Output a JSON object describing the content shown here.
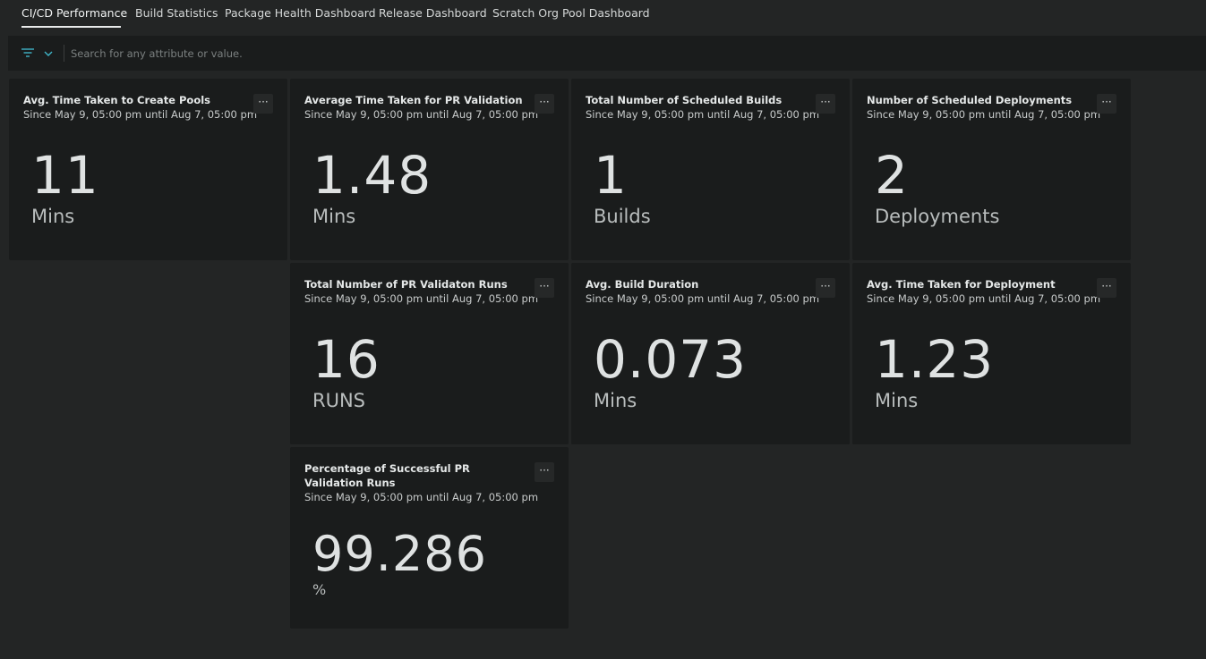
{
  "tabs": [
    {
      "label": "CI/CD Performance",
      "active": true
    },
    {
      "label": "Build Statistics"
    },
    {
      "label": "Package Health Dashboard"
    },
    {
      "label": "Release Dashboard"
    },
    {
      "label": "Scratch Org Pool Dashboard"
    }
  ],
  "filter": {
    "placeholder": "Search for any attribute or value.",
    "icons": [
      "filter-icon",
      "chevron-down-icon"
    ]
  },
  "range": "Since May 9, 05:00 pm until Aug 7, 05:00 pm",
  "menu_label": "···",
  "cards": [
    {
      "title": "Avg. Time Taken to Create Pools",
      "value": "11",
      "unit": "Mins"
    },
    {
      "title": "Average Time Taken for PR Validation",
      "value": "1.48",
      "unit": "Mins"
    },
    {
      "title": "Total Number of Scheduled Builds",
      "value": "1",
      "unit": "Builds"
    },
    {
      "title": "Number of Scheduled Deployments",
      "value": "2",
      "unit": "Deployments"
    },
    {
      "title": "Total Number of PR Validaton Runs",
      "value": "16",
      "unit": "RUNS"
    },
    {
      "title": "Avg. Build Duration",
      "value": "0.073",
      "unit": "Mins"
    },
    {
      "title": "Avg. Time Taken for Deployment",
      "value": "1.23",
      "unit": "Mins"
    },
    {
      "title": "Percentage of Successful PR Validation Runs",
      "value": "99.286",
      "unit": "%"
    }
  ],
  "colors": {
    "page_background": "#232525",
    "card_background": "#1a1c1c",
    "accent": "#3fb5c8"
  }
}
